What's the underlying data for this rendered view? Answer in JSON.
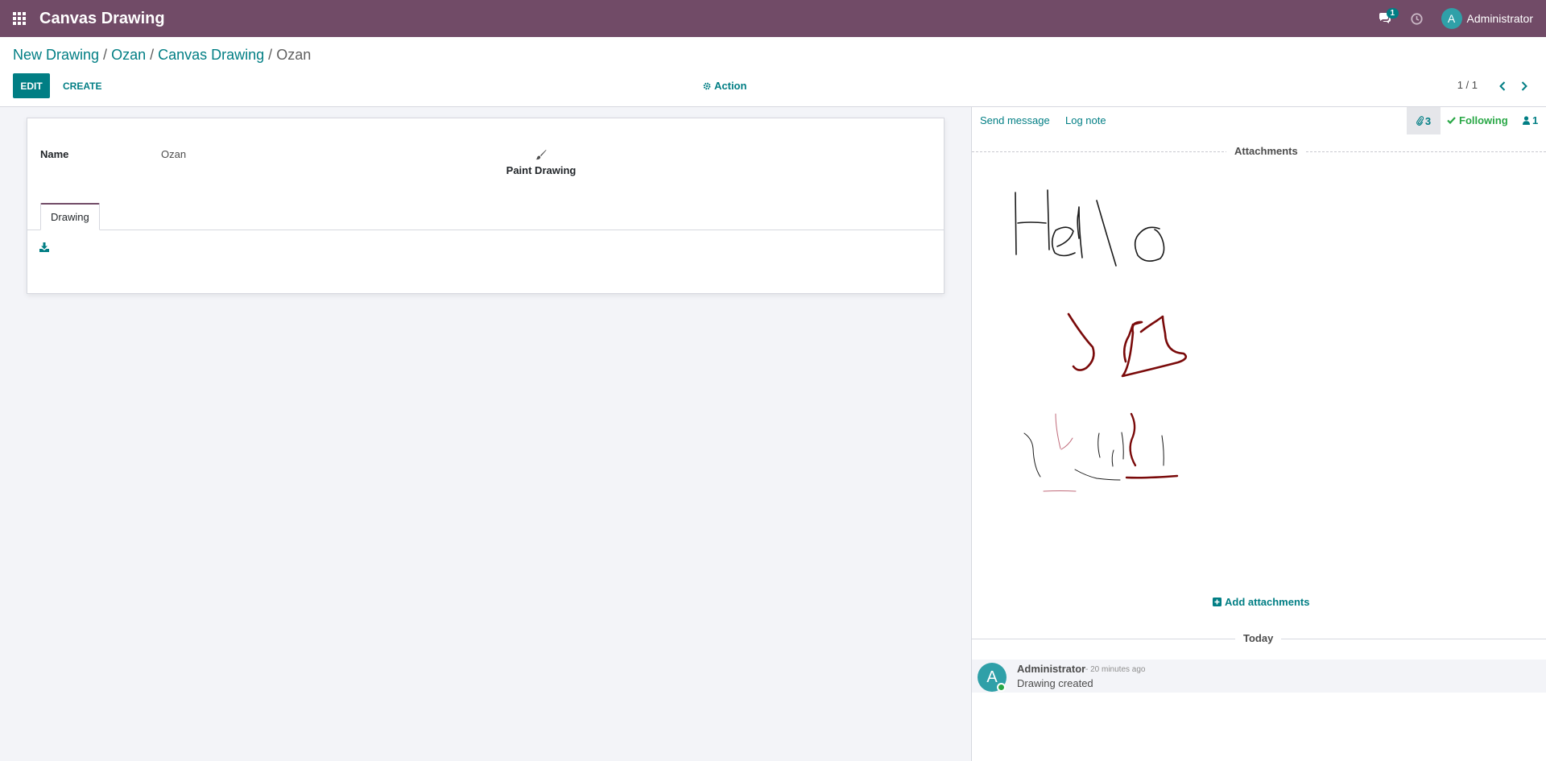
{
  "navbar": {
    "app_title": "Canvas Drawing",
    "messages_badge": "1",
    "user_initial": "A",
    "user_name": "Administrator"
  },
  "breadcrumb": {
    "items": [
      "New Drawing",
      "Ozan",
      "Canvas Drawing"
    ],
    "current": "Ozan"
  },
  "toolbar": {
    "edit_label": "EDIT",
    "create_label": "CREATE",
    "action_label": "Action",
    "pager": "1 / 1"
  },
  "form": {
    "name_label": "Name",
    "name_value": "Ozan",
    "paint_label": "Paint Drawing",
    "tab_label": "Drawing"
  },
  "chatter": {
    "send_message": "Send message",
    "log_note": "Log note",
    "attachment_count": "3",
    "following": "Following",
    "followers_count": "1",
    "attachments_title": "Attachments",
    "add_attachments": "Add attachments",
    "today": "Today",
    "message": {
      "avatar_initial": "A",
      "author": "Administrator",
      "time": "- 20 minutes ago",
      "body": "Drawing created"
    }
  },
  "colors": {
    "navbar": "#714b67",
    "primary": "#017e84",
    "following": "#28a745",
    "ink_dark": "#1a1a1a",
    "ink_red": "#7a0a0a"
  }
}
